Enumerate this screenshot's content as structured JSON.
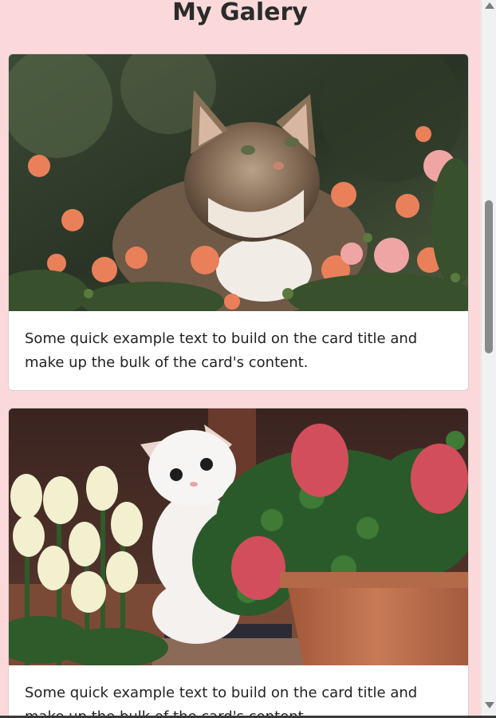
{
  "page": {
    "title": "My Galery"
  },
  "cards": [
    {
      "text": "Some quick example text to build on the card title and make up the bulk of the card's content."
    },
    {
      "text": "Some quick example text to build on the card title and make up the bulk of the card's content."
    }
  ],
  "colors": {
    "background": "#fbd9da",
    "card": "#ffffff",
    "text": "#222222"
  },
  "icons": {
    "scroll_up": "triangle-up",
    "scroll_down": "triangle-down"
  }
}
